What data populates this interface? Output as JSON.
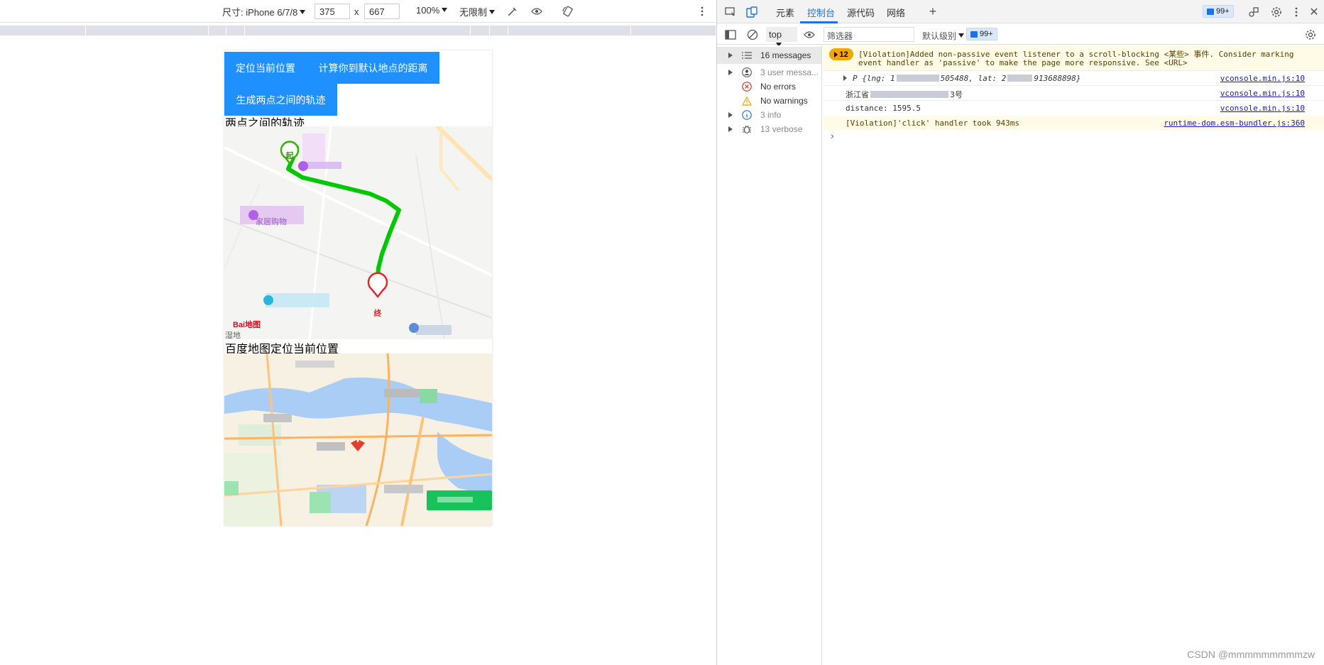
{
  "device_toolbar": {
    "dimensions_label": "尺寸: iPhone 6/7/8",
    "width": "375",
    "times": "x",
    "height": "667",
    "zoom": "100%",
    "throttle": "无限制"
  },
  "page": {
    "btn_locate": "定位当前位置",
    "btn_distance": "计算你到默认地点的距离",
    "btn_track": "生成两点之间的轨迹",
    "track_title": "两点之间的轨迹",
    "start_marker": "起",
    "end_marker": "终",
    "baidu_logo": "Bai地图",
    "map1_label_furniture": "家居购物",
    "map1_corner_label": "湿地",
    "locate_title": "百度地图定位当前位置"
  },
  "devtools": {
    "tabs": [
      {
        "label": "元素",
        "active": false
      },
      {
        "label": "控制台",
        "active": true
      },
      {
        "label": "源代码",
        "active": false
      },
      {
        "label": "网络",
        "active": false
      }
    ],
    "msg_badge": "99+",
    "context": "top",
    "filter_placeholder": "筛选器",
    "level": "默认级别",
    "filter_badge": "99+",
    "sidebar": [
      {
        "label": "16 messages",
        "icon": "list-icon"
      },
      {
        "label": "3 user messa...",
        "icon": "user-icon"
      },
      {
        "label": "No errors",
        "icon": "error-icon"
      },
      {
        "label": "No warnings",
        "icon": "warning-icon"
      },
      {
        "label": "3 info",
        "icon": "info-icon"
      },
      {
        "label": "13 verbose",
        "icon": "bug-icon"
      }
    ],
    "logs": {
      "warn_count": "12",
      "warn1_line1": "[Violation]Added non-passive event listener to a scroll-blocking <某些> 事件. Consider marking",
      "warn1_line2": "event handler as 'passive' to make the page more responsive. See <URL>",
      "obj_line": "P {lng: 1",
      "obj_mid": "505488, lat: 2",
      "obj_end": "913688898}",
      "src1": "vconsole.min.js:10",
      "addr_start": "浙江省",
      "addr_end": "3号",
      "src2": "vconsole.min.js:10",
      "distance": "distance: 1595.5",
      "src3": "vconsole.min.js:10",
      "violation_click": "[Violation]'click' handler took 943ms",
      "src4": "runtime-dom.esm-bundler.js:360",
      "prompt": "›"
    }
  },
  "watermark": "CSDN @mmmmmmmmmzw"
}
